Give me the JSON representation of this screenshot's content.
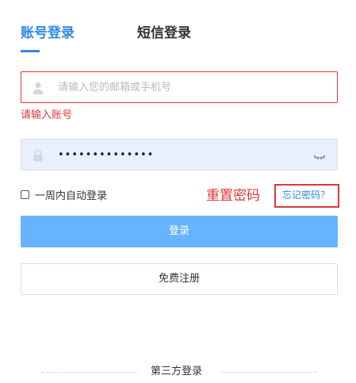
{
  "tabs": {
    "account_login": "账号登录",
    "sms_login": "短信登录"
  },
  "account": {
    "placeholder": "请输入您的邮箱或手机号",
    "value": "",
    "error": "请输入账号"
  },
  "password": {
    "value": "••••••••••••••"
  },
  "remember": {
    "label": "一周内自动登录",
    "checked": false
  },
  "annotation": {
    "label": "重置密码"
  },
  "forgot": {
    "label": "忘记密码？"
  },
  "buttons": {
    "login": "登录",
    "register": "免费注册"
  },
  "third_party": {
    "label": "第三方登录"
  },
  "colors": {
    "accent": "#2f8ae6",
    "error": "#e0353a",
    "login_button": "#68b3ff",
    "autofill_bg": "#e8f0fe"
  },
  "icons": {
    "account": "user-icon",
    "password": "lock-icon",
    "toggle": "eye-closed-icon"
  }
}
